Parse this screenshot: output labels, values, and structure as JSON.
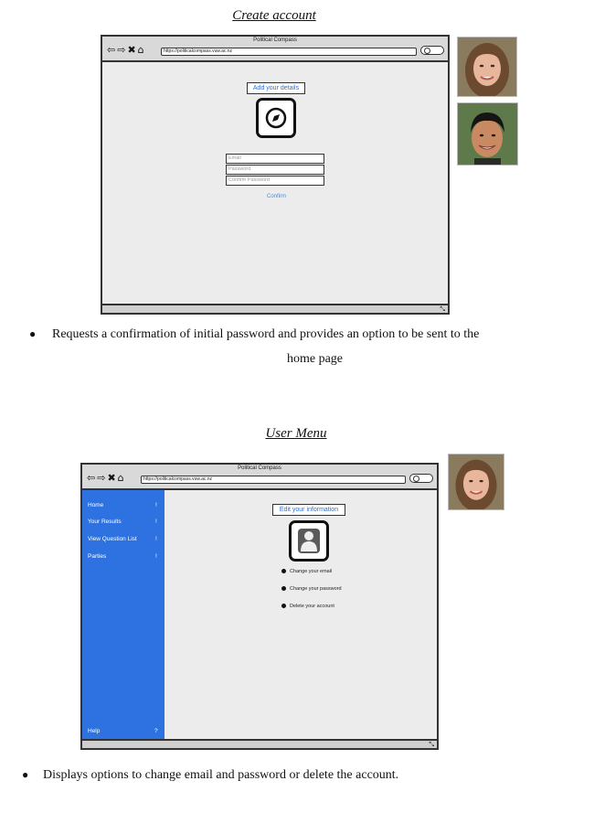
{
  "section1": {
    "heading": "Create account",
    "browser": {
      "window_title": "Political Compass",
      "url": "https://politicalcompass.vuw.ac.nz"
    },
    "label": "Add your details",
    "logo_icon": "compass-icon",
    "fields": [
      {
        "placeholder": "Email"
      },
      {
        "placeholder": "Password"
      },
      {
        "placeholder": "Confirm Password"
      }
    ],
    "confirm_label": "Confirm",
    "caption_line1": "Requests a confirmation of initial password and provides an option to be sent to the",
    "caption_line2": "home page"
  },
  "section2": {
    "heading": "User Menu",
    "browser": {
      "window_title": "Political Compass",
      "url": "https://politicalcompass.vuw.ac.nz"
    },
    "sidebar": {
      "items": [
        {
          "label": "Home",
          "marker": "!"
        },
        {
          "label": "Your Results",
          "marker": "!"
        },
        {
          "label": "View Question List",
          "marker": "!"
        },
        {
          "label": "Parties",
          "marker": "!"
        }
      ],
      "help": {
        "label": "Help",
        "marker": "?"
      },
      "color": "#2d72e0"
    },
    "label": "Edit your information",
    "avatar_icon": "user-icon",
    "options": [
      "Change your email",
      "Change your password",
      "Delete your account"
    ],
    "caption": "Displays options to change email and password or delete the account."
  },
  "icons": {
    "back": "⇦",
    "forward": "⇨",
    "close": "✖",
    "home": "⌂",
    "resize": "⤡"
  }
}
